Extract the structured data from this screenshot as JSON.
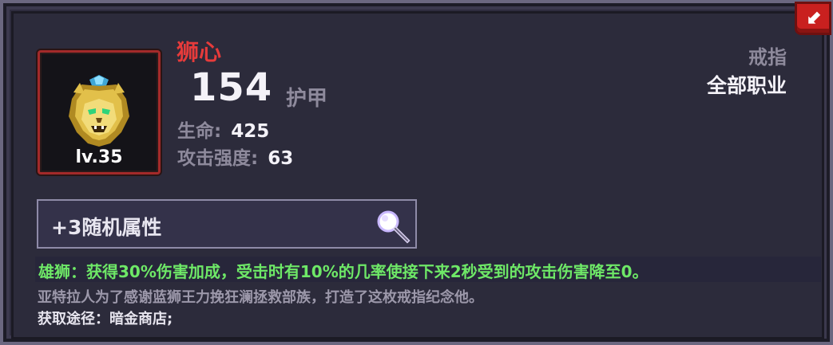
{
  "item": {
    "name": "狮心",
    "level": "lv.35",
    "armor_value": "154",
    "armor_label": "护甲",
    "stats": [
      {
        "label": "生命:",
        "value": "425"
      },
      {
        "label": "攻击强度:",
        "value": "63"
      }
    ],
    "type": "戒指",
    "class_restriction": "全部职业",
    "random_attributes": "+3随机属性",
    "effect": "雄狮：获得30%伤害加成，受击时有10%的几率使接下来2秒受到的攻击伤害降至0。",
    "lore": "亚特拉人为了感谢蓝狮王力挽狂澜拯救部族，打造了这枚戒指纪念他。",
    "source": "获取途径：暗金商店;"
  },
  "icons": {
    "item_icon": "golden-lion-head-icon",
    "magnifier": "magnifier-icon",
    "close": "close-icon"
  },
  "colors": {
    "name": "#e63b3b",
    "effect": "#6ee867",
    "panel_bg": "#2c2b3b",
    "slot_border": "#a32a2a",
    "close_bg": "#c9201f"
  }
}
